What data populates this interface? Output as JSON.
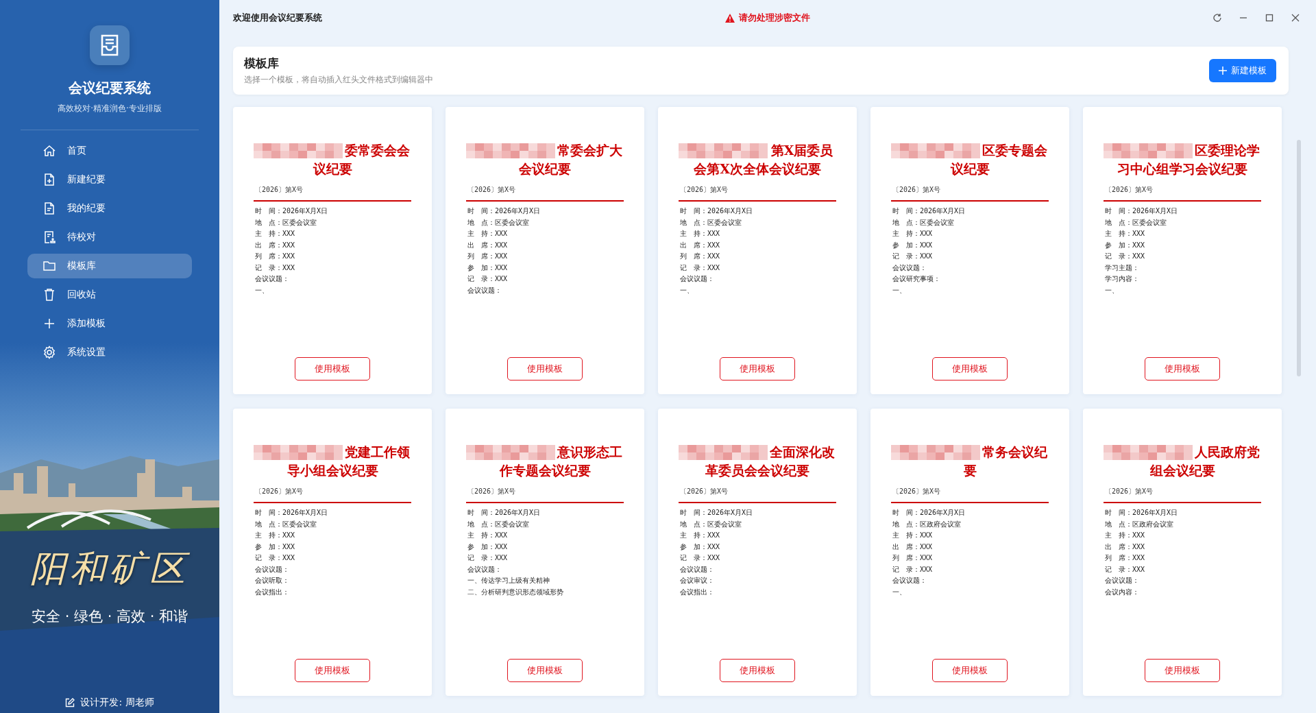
{
  "top_bar": {
    "title": "欢迎使用会议纪要系统",
    "warning": "请勿处理涉密文件"
  },
  "sidebar": {
    "app_title": "会议纪要系统",
    "tagline": "高效校对·精准润色·专业排版",
    "nav": [
      {
        "label": "首页",
        "kind": "home",
        "selected": false
      },
      {
        "label": "新建纪要",
        "kind": "create",
        "selected": false
      },
      {
        "label": "我的纪要",
        "kind": "mine",
        "selected": false
      },
      {
        "label": "待校对",
        "kind": "review",
        "selected": false
      },
      {
        "label": "模板库",
        "kind": "library",
        "selected": true
      },
      {
        "label": "回收站",
        "kind": "recycle",
        "selected": false
      },
      {
        "label": "添加模板",
        "kind": "add",
        "selected": false
      },
      {
        "label": "系统设置",
        "kind": "settings",
        "selected": false
      }
    ],
    "banner": {
      "kind": "picture",
      "place": "阳和矿区",
      "slogan": "安全 · 绿色 · 高效 · 和谐"
    },
    "footer": "设计开发: 周老师"
  },
  "header": {
    "title": "模板库",
    "subtitle": "选择一个模板，将自动插入红头文件格式到编辑器中",
    "new_button": "新建模板"
  },
  "templates": [
    {
      "title": "委常委会会议纪要",
      "doc_number": "〔2026〕第X号",
      "lines": [
        "时　间：2026年X月X日",
        "地　点：区委会议室",
        "主　持：XXX",
        "出　席：XXX",
        "列　席：XXX",
        "记　录：XXX",
        "会议议题：",
        "一、"
      ],
      "button": "使用模板"
    },
    {
      "title": "常委会扩大会议纪要",
      "doc_number": "〔2026〕第X号",
      "lines": [
        "时　间：2026年X月X日",
        "地　点：区委会议室",
        "主　持：XXX",
        "出　席：XXX",
        "列　席：XXX",
        "参　加：XXX",
        "记　录：XXX",
        "会议议题："
      ],
      "button": "使用模板"
    },
    {
      "title": "第X届委员会第X次全体会议纪要",
      "doc_number": "〔2026〕第X号",
      "lines": [
        "时　间：2026年X月X日",
        "地　点：区委会议室",
        "主　持：XXX",
        "出　席：XXX",
        "列　席：XXX",
        "记　录：XXX",
        "会议议题：",
        "一、"
      ],
      "button": "使用模板"
    },
    {
      "title": "区委专题会议纪要",
      "doc_number": "〔2026〕第X号",
      "lines": [
        "时　间：2026年X月X日",
        "地　点：区委会议室",
        "主　持：XXX",
        "参　加：XXX",
        "记　录：XXX",
        "会议议题：",
        "会议研究事项：",
        "一、"
      ],
      "button": "使用模板"
    },
    {
      "title": "区委理论学习中心组学习会议纪要",
      "doc_number": "〔2026〕第X号",
      "lines": [
        "时　间：2026年X月X日",
        "地　点：区委会议室",
        "主　持：XXX",
        "参　加：XXX",
        "记　录：XXX",
        "学习主题：",
        "学习内容：",
        "一、"
      ],
      "button": "使用模板"
    },
    {
      "title": "党建工作领导小组会议纪要",
      "doc_number": "〔2026〕第X号",
      "lines": [
        "时　间：2026年X月X日",
        "地　点：区委会议室",
        "主　持：XXX",
        "参　加：XXX",
        "记　录：XXX",
        "会议议题：",
        "会议听取：",
        "会议指出："
      ],
      "button": "使用模板"
    },
    {
      "title": "意识形态工作专题会议纪要",
      "doc_number": "〔2026〕第X号",
      "lines": [
        "时　间：2026年X月X日",
        "地　点：区委会议室",
        "主　持：XXX",
        "参　加：XXX",
        "记　录：XXX",
        "会议议题：",
        "一、传达学习上级有关精神",
        "二、分析研判意识形态领域形势"
      ],
      "button": "使用模板"
    },
    {
      "title": "全面深化改革委员会会议纪要",
      "doc_number": "〔2026〕第X号",
      "lines": [
        "时　间：2026年X月X日",
        "地　点：区委会议室",
        "主　持：XXX",
        "参　加：XXX",
        "记　录：XXX",
        "会议议题：",
        "会议审议：",
        "会议指出："
      ],
      "button": "使用模板"
    },
    {
      "title": "常务会议纪要",
      "doc_number": "〔2026〕第X号",
      "lines": [
        "时　间：2026年X月X日",
        "地　点：区政府会议室",
        "主　持：XXX",
        "出　席：XXX",
        "列　席：XXX",
        "记　录：XXX",
        "会议议题：",
        "一、"
      ],
      "button": "使用模板"
    },
    {
      "title": "人民政府党组会议纪要",
      "doc_number": "〔2026〕第X号",
      "lines": [
        "时　间：2026年X月X日",
        "地　点：区政府会议室",
        "主　持：XXX",
        "出　席：XXX",
        "列　席：XXX",
        "记　录：XXX",
        "会议议题：",
        "会议内容："
      ],
      "button": "使用模板"
    }
  ]
}
